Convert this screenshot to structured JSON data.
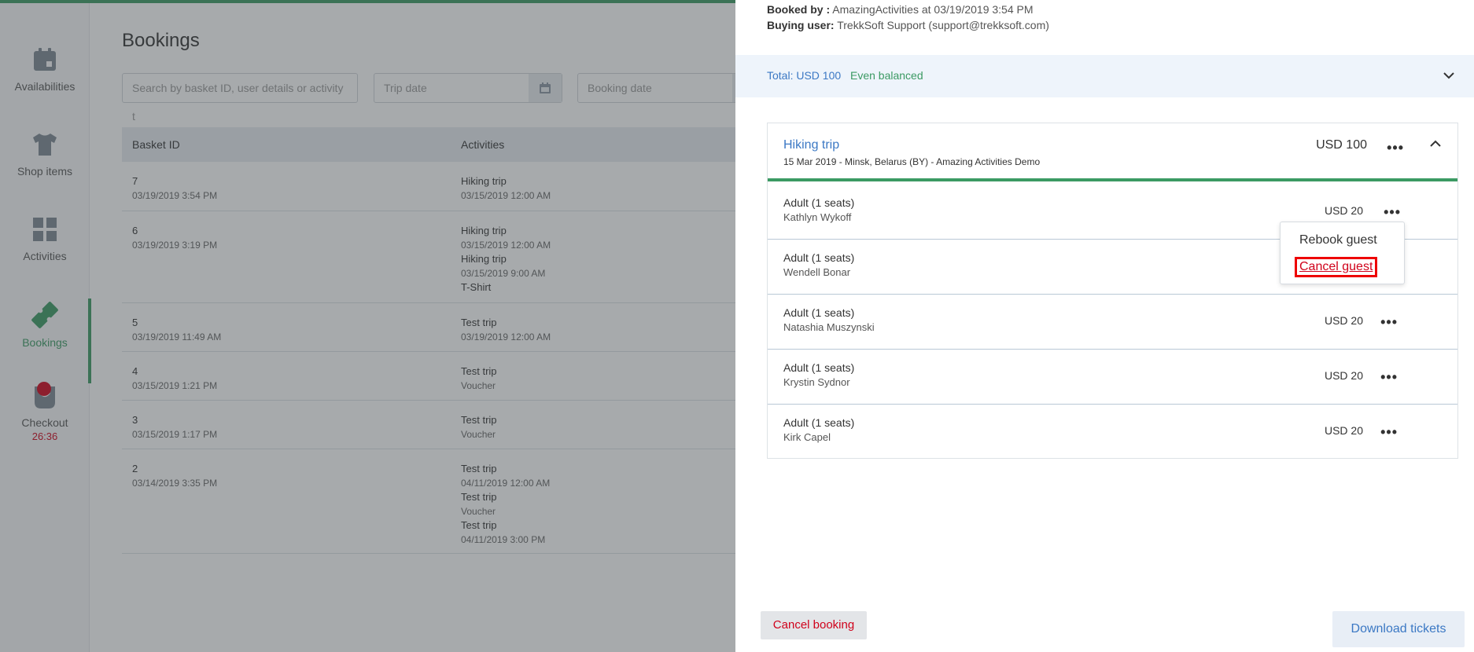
{
  "sidebar": {
    "items": [
      {
        "label": "Availabilities",
        "icon": "calendar-icon"
      },
      {
        "label": "Shop items",
        "icon": "tshirt-icon"
      },
      {
        "label": "Activities",
        "icon": "grid-icon"
      },
      {
        "label": "Bookings",
        "icon": "ticket-icon"
      },
      {
        "label": "Checkout",
        "icon": "bag-icon",
        "timer": "26:36"
      }
    ]
  },
  "main": {
    "title": "Bookings",
    "search_placeholder": "Search by basket ID, user details or activity t",
    "trip_date_placeholder": "Trip date",
    "booking_date_placeholder": "Booking date",
    "columns": [
      "Basket ID",
      "Activities"
    ],
    "rows": [
      {
        "id": "7",
        "date": "03/19/2019 3:54 PM",
        "activities": [
          [
            "Hiking trip",
            "03/15/2019 12:00 AM"
          ]
        ]
      },
      {
        "id": "6",
        "date": "03/19/2019 3:19 PM",
        "activities": [
          [
            "Hiking trip",
            "03/15/2019 12:00 AM"
          ],
          [
            "Hiking trip",
            "03/15/2019 9:00 AM"
          ],
          [
            "T-Shirt",
            ""
          ]
        ]
      },
      {
        "id": "5",
        "date": "03/19/2019 11:49 AM",
        "activities": [
          [
            "Test trip",
            "03/19/2019 12:00 AM"
          ]
        ]
      },
      {
        "id": "4",
        "date": "03/15/2019 1:21 PM",
        "activities": [
          [
            "Test trip",
            "Voucher"
          ]
        ]
      },
      {
        "id": "3",
        "date": "03/15/2019 1:17 PM",
        "activities": [
          [
            "Test trip",
            "Voucher"
          ]
        ]
      },
      {
        "id": "2",
        "date": "03/14/2019 3:35 PM",
        "activities": [
          [
            "Test trip",
            "04/11/2019 12:00 AM"
          ],
          [
            "Test trip",
            "Voucher"
          ],
          [
            "Test trip",
            "04/11/2019 3:00 PM"
          ]
        ]
      }
    ]
  },
  "drawer": {
    "booked_by_label": "Booked by :",
    "booked_by_value": "AmazingActivities at 03/19/2019 3:54 PM",
    "buying_user_label": "Buying user:",
    "buying_user_value": "TrekkSoft Support (support@trekksoft.com)",
    "total": "Total: USD 100",
    "balance_status": "Even balanced",
    "trip": {
      "title": "Hiking trip",
      "subtitle": "15 Mar 2019 - Minsk, Belarus (BY) - Amazing Activities Demo",
      "price": "USD 100"
    },
    "guests": [
      {
        "type": "Adult (1 seats)",
        "name": "Kathlyn Wykoff",
        "price": "USD 20"
      },
      {
        "type": "Adult (1 seats)",
        "name": "Wendell Bonar",
        "price": ""
      },
      {
        "type": "Adult (1 seats)",
        "name": "Natashia Muszynski",
        "price": "USD 20"
      },
      {
        "type": "Adult (1 seats)",
        "name": "Krystin Sydnor",
        "price": "USD 20"
      },
      {
        "type": "Adult (1 seats)",
        "name": "Kirk Capel",
        "price": "USD 20"
      }
    ],
    "menu": {
      "rebook": "Rebook guest",
      "cancel": "Cancel guest"
    },
    "cancel_booking": "Cancel booking",
    "download_tickets": "Download tickets"
  },
  "colors": {
    "brand_green": "#3b9a63",
    "link_blue": "#3b78c4",
    "danger_red": "#d0021b"
  }
}
